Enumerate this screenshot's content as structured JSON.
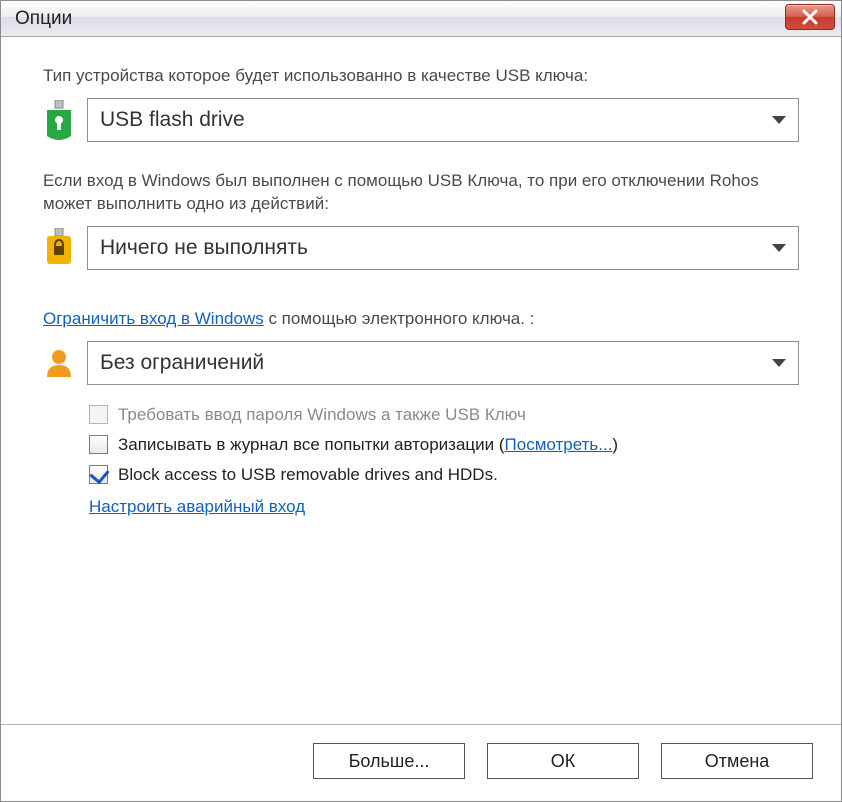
{
  "window": {
    "title": "Опции"
  },
  "device_type": {
    "label": "Тип устройства которое будет использованно в качестве USB ключа:",
    "value": "USB flash drive"
  },
  "on_remove": {
    "label": "Если вход в Windows был выполнен с помощью USB Ключа, то при его отключении Rohos может выполнить одно из действий:",
    "value": "Ничего не выполнять"
  },
  "restrict": {
    "link_text": "Ограничить вход в Windows",
    "label_suffix": " с помощью электронного ключа. :",
    "value": "Без ограничений"
  },
  "checkboxes": {
    "require_password": {
      "label": "Требовать ввод пароля Windows а также USB Ключ",
      "checked": false,
      "disabled": true
    },
    "log_attempts": {
      "label": "Записывать в журнал все попытки авторизации (",
      "view_link": "Посмотреть...",
      "suffix": ")",
      "checked": false
    },
    "block_usb": {
      "label": "Block access to USB removable drives and HDDs.",
      "checked": true
    }
  },
  "links": {
    "emergency": "Настроить аварийный вход"
  },
  "buttons": {
    "more": "Больше...",
    "ok": "ОК",
    "cancel": "Отмена"
  }
}
